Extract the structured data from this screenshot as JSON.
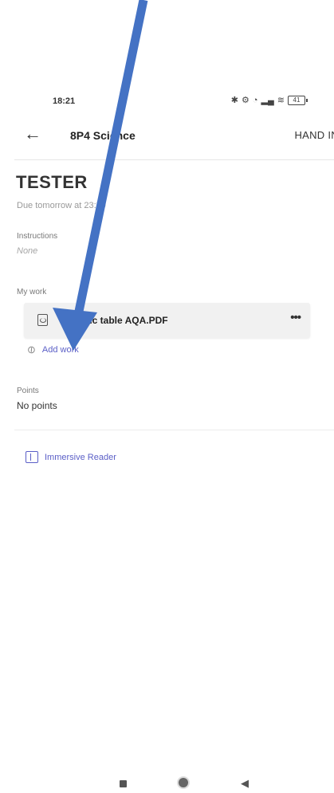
{
  "status_bar": {
    "time": "18:21",
    "battery_level": "41"
  },
  "header": {
    "class_title": "8P4 Science",
    "hand_in_label": "HAND IN"
  },
  "assignment": {
    "title": "TESTER",
    "due": "Due tomorrow at 23:59",
    "instructions_label": "Instructions",
    "instructions_value": "None",
    "my_work_label": "My work",
    "file_name": "Periodic table AQA.PDF",
    "more_label": "•••",
    "add_work_label": "Add work",
    "points_label": "Points",
    "points_value": "No points",
    "immersive_reader_label": "Immersive Reader"
  },
  "colors": {
    "accent": "#5b5fc7",
    "annotation_arrow": "#4472c4"
  },
  "icons": [
    "back-arrow-icon",
    "pdf-file-icon",
    "paperclip-icon",
    "more-icon",
    "immersive-reader-icon"
  ]
}
